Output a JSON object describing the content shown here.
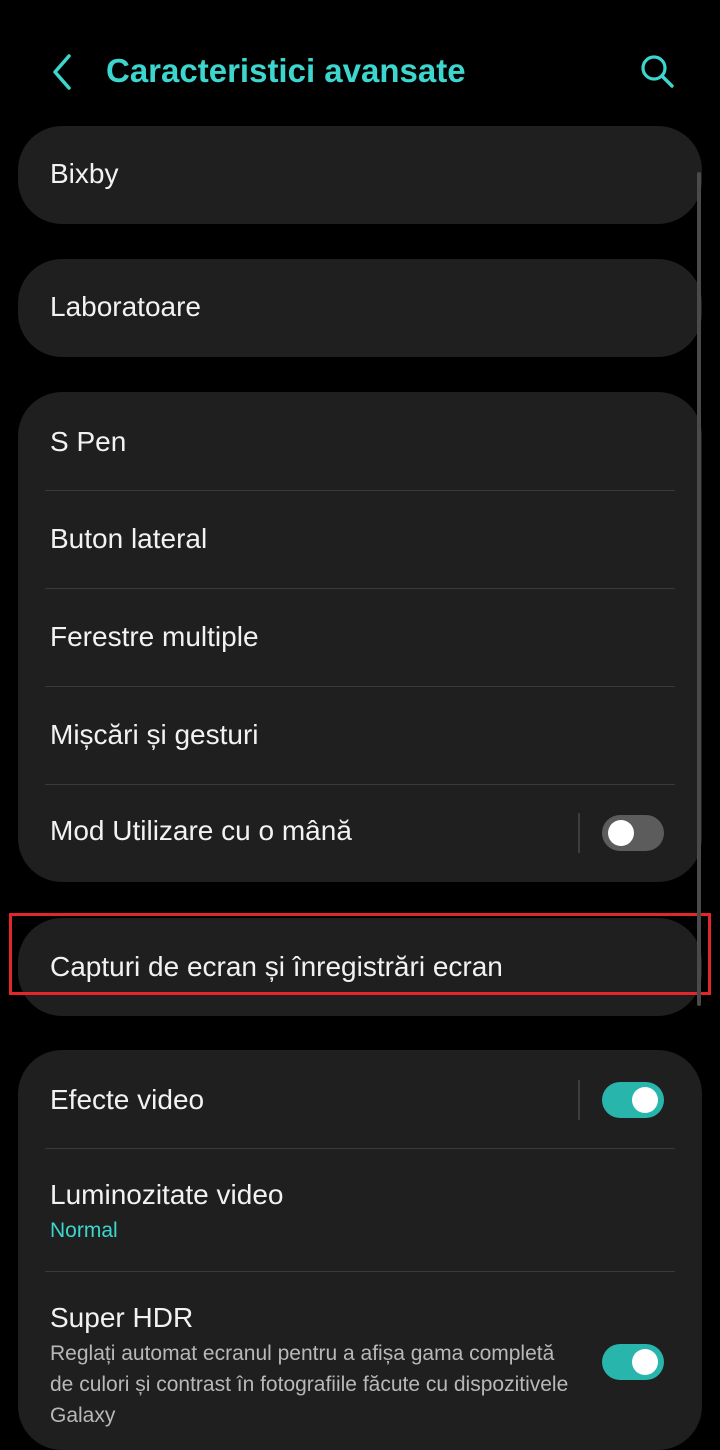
{
  "header": {
    "title": "Caracteristici avansate",
    "back_icon": "chevron-left-icon",
    "search_icon": "search-icon"
  },
  "colors": {
    "accent": "#3dd6cf",
    "card_bg": "#1f1f1f",
    "toggle_on": "#28b5ac",
    "toggle_off": "#5c5c5c",
    "highlight": "#e3252c"
  },
  "cards": {
    "bixby": {
      "label": "Bixby"
    },
    "labs": {
      "label": "Laboratoare"
    },
    "group1": {
      "s_pen": "S Pen",
      "side_button": "Buton lateral",
      "multi_window": "Ferestre multiple",
      "motions": "Mișcări și gesturi",
      "one_hand": {
        "label": "Mod Utilizare cu o mână",
        "enabled": false
      }
    },
    "screenshots": {
      "label": "Capturi de ecran și înregistrări ecran",
      "highlighted": true
    },
    "video": {
      "effects": {
        "label": "Efecte video",
        "enabled": true
      },
      "brightness": {
        "label": "Luminozitate video",
        "value": "Normal"
      },
      "super_hdr": {
        "label": "Super HDR",
        "description": "Reglați automat ecranul pentru a afișa gama completă de culori și contrast în fotografiile făcute cu dispozitivele Galaxy",
        "enabled": true
      }
    }
  }
}
